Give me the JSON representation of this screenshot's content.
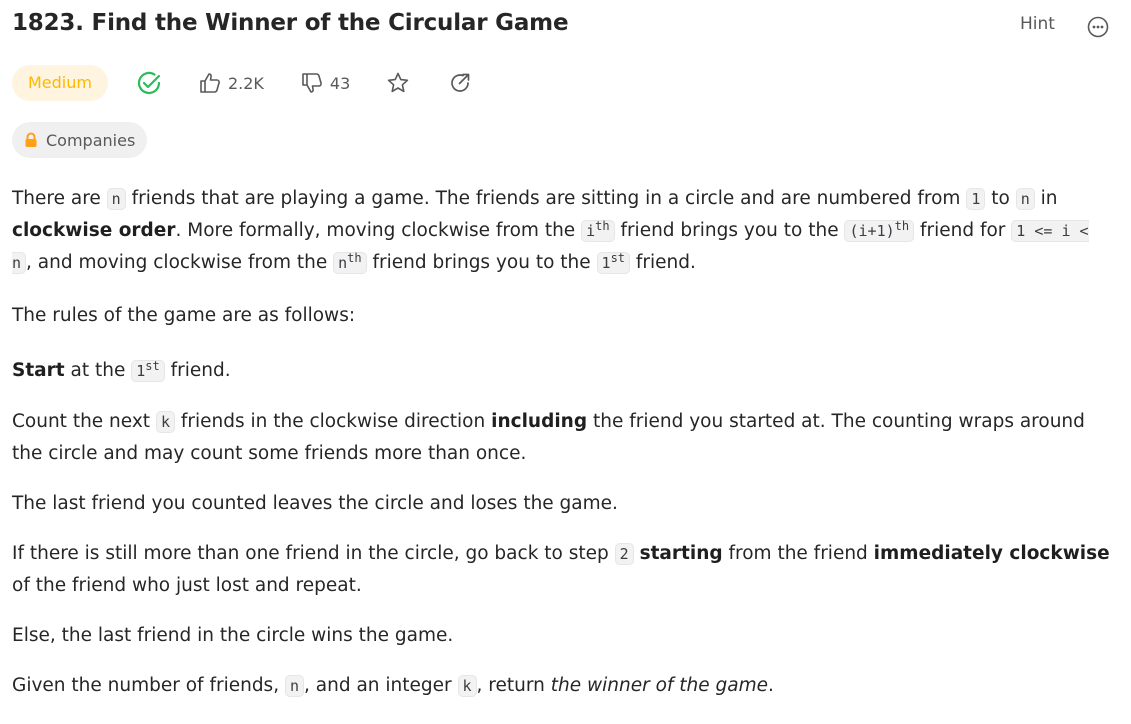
{
  "problem": {
    "title": "1823. Find the Winner of the Circular Game",
    "difficulty": "Medium",
    "likes": "2.2K",
    "dislikes": "43",
    "companies_label": "Companies"
  },
  "header": {
    "hint_label": "Hint"
  },
  "colors": {
    "medium": "#ffb800",
    "solved": "#2cbb5d",
    "text": "#262626"
  },
  "icons": {
    "solved": "check-circle-icon",
    "like": "thumbs-up-icon",
    "dislike": "thumbs-down-icon",
    "favorite": "star-icon",
    "share": "share-icon",
    "companies": "lock-icon",
    "more": "more-options-icon"
  },
  "description": {
    "p1": {
      "t1": "There are ",
      "c_n1": "n",
      "t2": " friends that are playing a game. The friends are sitting in a circle and are numbered from ",
      "c_1": "1",
      "t3": " to ",
      "c_n2": "n",
      "t4": " in ",
      "b1": "clockwise order",
      "t5": ". More formally, moving clockwise from the ",
      "c_i": "i",
      "sup_th1": "th",
      "t6": " friend brings you to the ",
      "c_i1": "(i+1)",
      "sup_th2": "th",
      "t7": " friend for ",
      "c_range": "1 <= i < n",
      "t8": ", and moving clockwise from the ",
      "c_n3": "n",
      "sup_th3": "th",
      "t9": " friend brings you to the ",
      "c_1b": "1",
      "sup_st": "st",
      "t10": " friend."
    },
    "p2": "The rules of the game are as follows:",
    "p3": {
      "b": "Start",
      "t1": " at the ",
      "c_1": "1",
      "sup_st": "st",
      "t2": " friend."
    },
    "p4": {
      "t1": "Count the next ",
      "c_k": "k",
      "t2": " friends in the clockwise direction ",
      "b": "including",
      "t3": " the friend you started at. The counting wraps around the circle and may count some friends more than once."
    },
    "p5": "The last friend you counted leaves the circle and loses the game.",
    "p6": {
      "t1": "If there is still more than one friend in the circle, go back to step ",
      "c_2": "2",
      "t2": " ",
      "b1": "starting",
      "t3": " from the friend ",
      "b2": "immediately clockwise",
      "t4": " of the friend who just lost and repeat."
    },
    "p7": "Else, the last friend in the circle wins the game.",
    "p8": {
      "t1": "Given the number of friends, ",
      "c_n": "n",
      "t2": ", and an integer ",
      "c_k": "k",
      "t3": ", return ",
      "i": "the winner of the game",
      "t4": "."
    }
  }
}
